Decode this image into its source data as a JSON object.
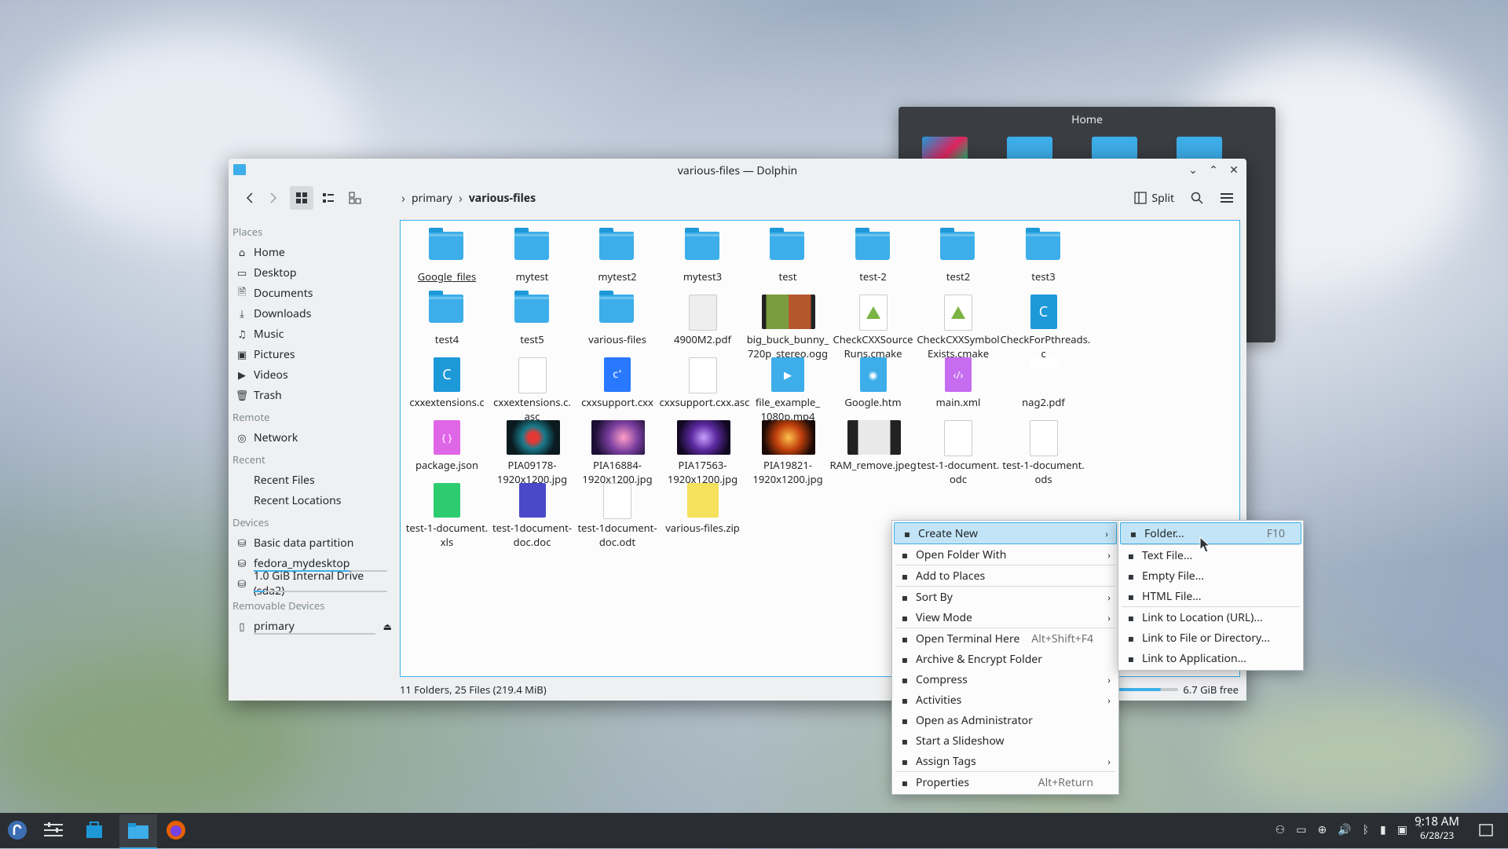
{
  "home_preview": {
    "title": "Home"
  },
  "window": {
    "title": "various-files — Dolphin",
    "breadcrumb": [
      "primary",
      "various-files"
    ],
    "split_label": "Split"
  },
  "sidebar": {
    "places_header": "Places",
    "places": [
      "Home",
      "Desktop",
      "Documents",
      "Downloads",
      "Music",
      "Pictures",
      "Videos",
      "Trash"
    ],
    "remote_header": "Remote",
    "remote": [
      "Network"
    ],
    "recent_header": "Recent",
    "recent": [
      "Recent Files",
      "Recent Locations"
    ],
    "devices_header": "Devices",
    "devices": [
      "Basic data partition",
      "fedora_mydesktop",
      "1.0 GiB Internal Drive (sda2)"
    ],
    "removable_header": "Removable Devices",
    "removable": [
      "primary"
    ]
  },
  "files": [
    [
      "Google_files",
      "folder"
    ],
    [
      "mytest",
      "folder"
    ],
    [
      "mytest2",
      "folder"
    ],
    [
      "mytest3",
      "folder"
    ],
    [
      "test",
      "folder"
    ],
    [
      "test-2",
      "folder"
    ],
    [
      "test2",
      "folder"
    ],
    [
      "test3",
      "folder"
    ],
    [
      "test4",
      "folder"
    ],
    [
      "test5",
      "folder"
    ],
    [
      "various-files",
      "folder"
    ],
    [
      "4900M2.pdf",
      "pdf"
    ],
    [
      "big_buck_bunny_\n720p_stereo.ogg",
      "video"
    ],
    [
      "CheckCXXSource\nRuns.cmake",
      "cmake"
    ],
    [
      "CheckCXXSymbol\nExists.cmake",
      "cmake"
    ],
    [
      "CheckForPthreads.\nc",
      "c"
    ],
    [
      "cxxextensions.c",
      "c"
    ],
    [
      "cxxextensions.c.\nasc",
      "text"
    ],
    [
      "cxxsupport.cxx",
      "cxx"
    ],
    [
      "cxxsupport.cxx.asc",
      "text"
    ],
    [
      "file_example_\n1080p.mp4",
      "mp4"
    ],
    [
      "Google.htm",
      "htm"
    ],
    [
      "main.xml",
      "xml"
    ],
    [
      "nag2.pdf",
      "pdf2"
    ],
    [
      "package.json",
      "json"
    ],
    [
      "PIA09178-\n1920x1200.jpg",
      "img1"
    ],
    [
      "PIA16884-\n1920x1200.jpg",
      "img2"
    ],
    [
      "PIA17563-\n1920x1200.jpg",
      "img3"
    ],
    [
      "PIA19821-\n1920x1200.jpg",
      "img4"
    ],
    [
      "RAM_remove.jpeg",
      "img5"
    ],
    [
      "test-1-document.\nodc",
      "blank"
    ],
    [
      "test-1-document.\nods",
      "blank"
    ],
    [
      "test-1-document.\nxls",
      "xls"
    ],
    [
      "test-1document-\ndoc.doc",
      "doc"
    ],
    [
      "test-1document-\ndoc.odt",
      "blank"
    ],
    [
      "various-files.zip",
      "zip"
    ]
  ],
  "status": {
    "summary": "11 Folders, 25 Files (219.4 MiB)",
    "free": "6.7 GiB free",
    "free_fraction": 0.78
  },
  "context_menu": {
    "items": [
      {
        "label": "Create New",
        "icon": "plus-icon",
        "submenu": true,
        "highlighted": true
      },
      {
        "label": "Open Folder With",
        "icon": "window-icon",
        "submenu": true
      },
      {
        "sep": true
      },
      {
        "label": "Add to Places",
        "icon": "bookmark-icon"
      },
      {
        "sep": true
      },
      {
        "label": "Sort By",
        "icon": "sort-icon",
        "submenu": true
      },
      {
        "label": "View Mode",
        "icon": "view-mode-icon",
        "submenu": true
      },
      {
        "sep": true
      },
      {
        "label": "Open Terminal Here",
        "icon": "terminal-icon",
        "shortcut": "Alt+Shift+F4"
      },
      {
        "label": "Archive & Encrypt Folder",
        "icon": "lock-icon"
      },
      {
        "label": "Compress",
        "icon": "archive-icon",
        "submenu": true
      },
      {
        "label": "Activities",
        "icon": "activities-icon",
        "submenu": true
      },
      {
        "label": "Open as Administrator",
        "icon": "admin-icon"
      },
      {
        "label": "Start a Slideshow",
        "icon": "slideshow-icon"
      },
      {
        "label": "Assign Tags",
        "icon": "tag-icon",
        "submenu": true
      },
      {
        "sep": true
      },
      {
        "label": "Properties",
        "icon": "properties-icon",
        "shortcut": "Alt+Return"
      }
    ]
  },
  "submenu": {
    "items": [
      {
        "label": "Folder...",
        "icon": "folder-icon",
        "shortcut": "F10",
        "highlighted": true
      },
      {
        "sep": true
      },
      {
        "label": "Text File...",
        "icon": "text-file-icon"
      },
      {
        "label": "Empty File...",
        "icon": "empty-file-icon"
      },
      {
        "label": "HTML File...",
        "icon": "html-file-icon"
      },
      {
        "sep": true
      },
      {
        "label": "Link to Location (URL)...",
        "icon": "globe-icon"
      },
      {
        "label": "Link to File or Directory...",
        "icon": "link-icon"
      },
      {
        "label": "Link to Application...",
        "icon": "app-link-icon"
      }
    ]
  },
  "taskbar": {
    "time": "9:18 AM",
    "date": "6/28/23"
  },
  "colors": {
    "accent": "#3daee9",
    "taskbar": "#2a2e32",
    "menu_highlight": "#c2e4f6"
  }
}
